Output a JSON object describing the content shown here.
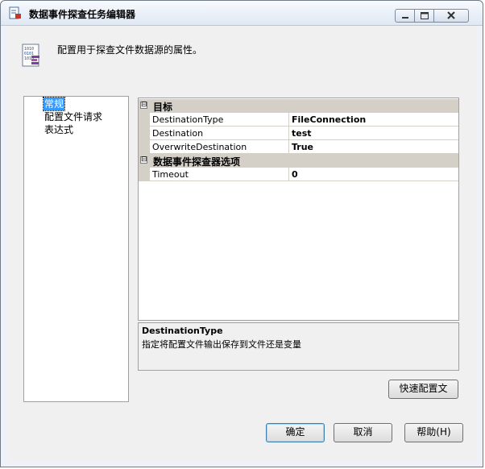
{
  "window": {
    "title": "数据事件探查任务编辑器"
  },
  "header": {
    "description": "配置用于探查文件数据源的属性。"
  },
  "nav": {
    "items": [
      {
        "label": "常规",
        "selected": true
      },
      {
        "label": "配置文件请求",
        "selected": false
      },
      {
        "label": "表达式",
        "selected": false
      }
    ]
  },
  "property_grid": {
    "categories": [
      {
        "label": "目标",
        "toggle": "⊟",
        "properties": [
          {
            "name": "DestinationType",
            "value": "FileConnection"
          },
          {
            "name": "Destination",
            "value": "test"
          },
          {
            "name": "OverwriteDestination",
            "value": "True"
          }
        ]
      },
      {
        "label": "数据事件探查器选项",
        "toggle": "⊟",
        "properties": [
          {
            "name": "Timeout",
            "value": "0"
          }
        ]
      }
    ]
  },
  "description_panel": {
    "title": "DestinationType",
    "text": "指定将配置文件输出保存到文件还是变量"
  },
  "buttons": {
    "quick_profile": "快速配置文",
    "ok": "确定",
    "cancel": "取消",
    "help": "帮助(H)"
  },
  "colors": {
    "selection": "#3399ff",
    "category_bg": "#d4d0c8"
  }
}
